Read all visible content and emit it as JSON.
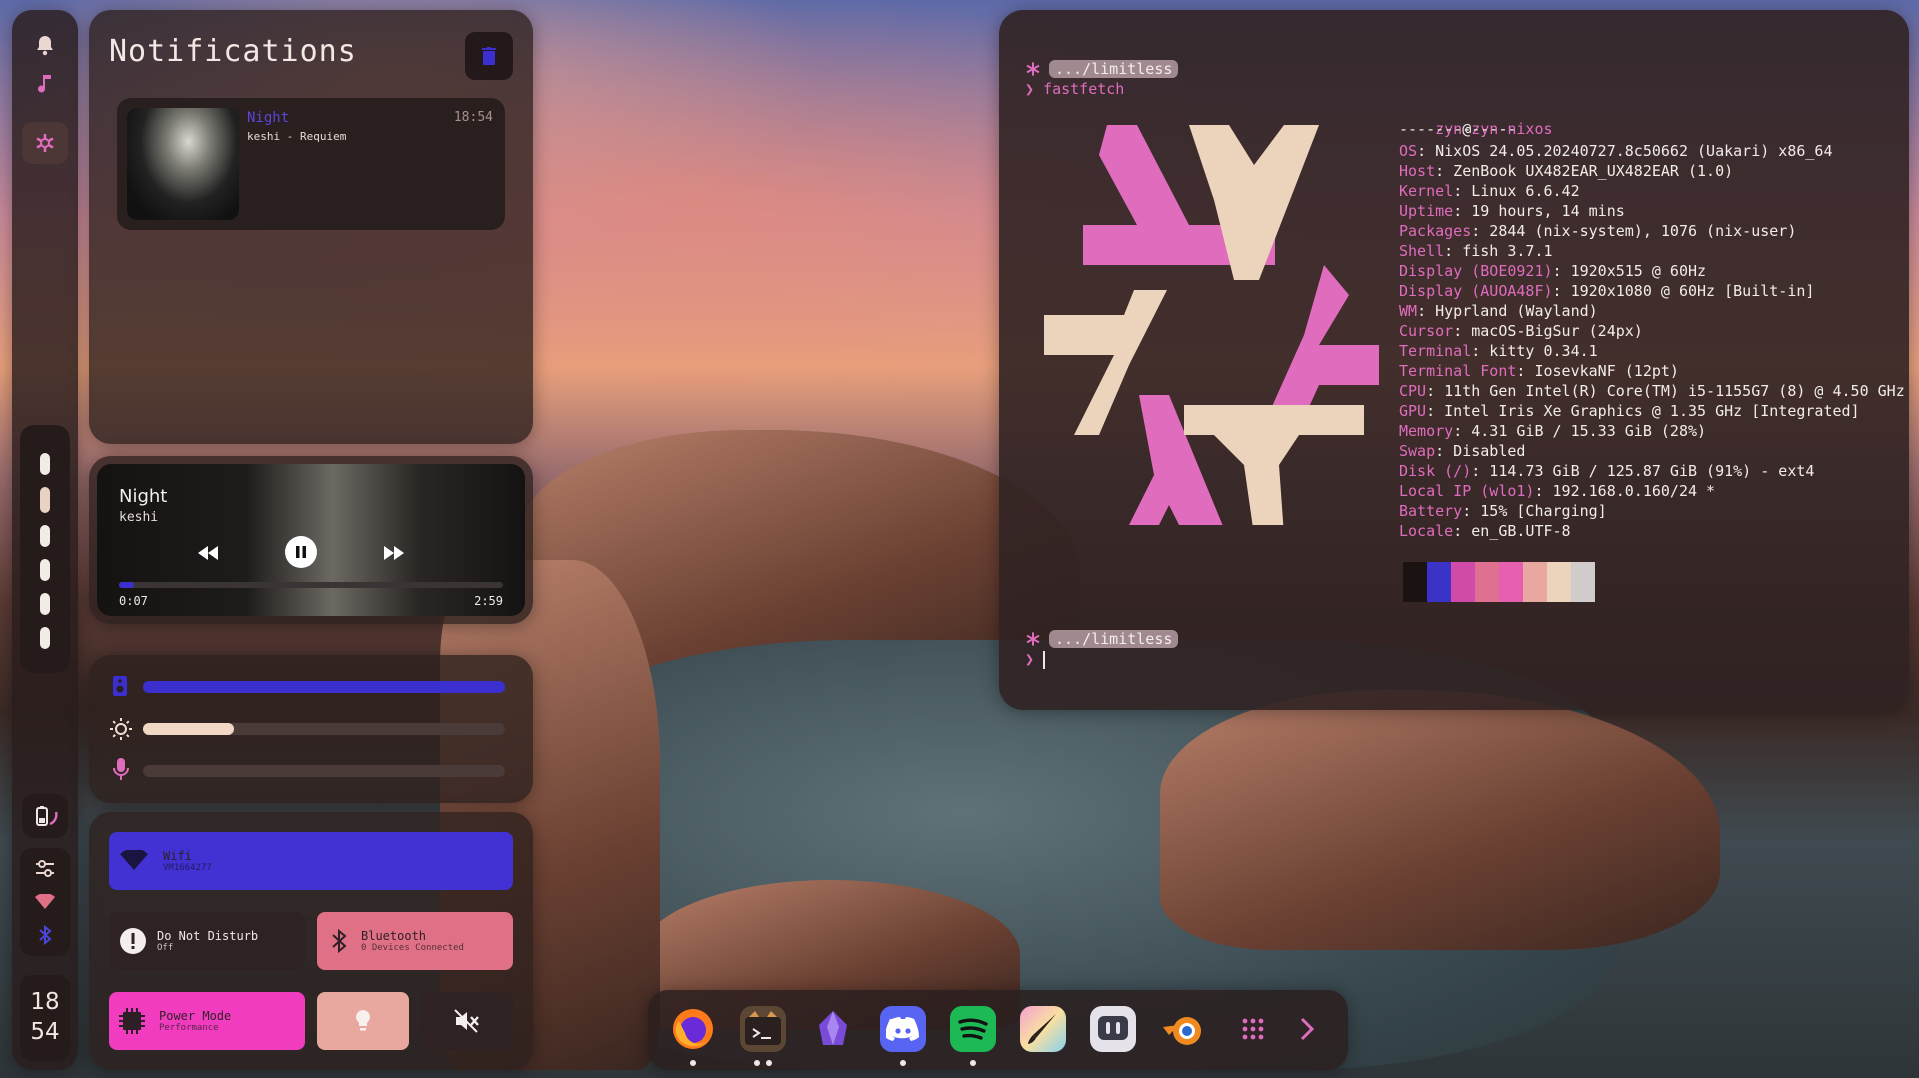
{
  "sidebar": {
    "clock_hour": "18",
    "clock_minute": "54",
    "workspaces": [
      {
        "state": "active-top"
      },
      {
        "state": "dim"
      },
      {
        "state": "normal"
      },
      {
        "state": "normal"
      },
      {
        "state": "normal"
      },
      {
        "state": "normal"
      }
    ]
  },
  "notifications": {
    "title": "Notifications",
    "items": [
      {
        "title": "Night",
        "body": "keshi - Requiem",
        "time": "18:54"
      }
    ]
  },
  "player": {
    "title": "Night",
    "artist": "keshi",
    "elapsed": "0:07",
    "duration": "2:59",
    "progress_fraction": 0.04
  },
  "sliders": {
    "volume_fraction": 1.0,
    "brightness_fraction": 0.25,
    "mic_fraction": 0.0
  },
  "toggles": {
    "wifi_label": "Wifi",
    "wifi_sub": "VM1664277",
    "dnd_label": "Do Not Disturb",
    "dnd_sub": "Off",
    "bt_label": "Bluetooth",
    "bt_sub": "0 Devices Connected",
    "power_label": "Power Mode",
    "power_sub": "Performance"
  },
  "terminal": {
    "prompt_path": ".../limitless",
    "command": "fastfetch",
    "user": "zyn",
    "at": "@",
    "host": "zyn-nixos",
    "separator": "-------------",
    "info": [
      {
        "key": "OS",
        "value": " NixOS 24.05.20240727.8c50662 (Uakari) x86_64"
      },
      {
        "key": "Host",
        "value": " ZenBook UX482EAR_UX482EAR (1.0)"
      },
      {
        "key": "Kernel",
        "value": " Linux 6.6.42"
      },
      {
        "key": "Uptime",
        "value": " 19 hours, 14 mins"
      },
      {
        "key": "Packages",
        "value": " 2844 (nix-system), 1076 (nix-user)"
      },
      {
        "key": "Shell",
        "value": " fish 3.7.1"
      },
      {
        "key": "Display (BOE0921)",
        "value": " 1920x515 @ 60Hz"
      },
      {
        "key": "Display (AUOA48F)",
        "value": " 1920x1080 @ 60Hz [Built-in]"
      },
      {
        "key": "WM",
        "value": " Hyprland (Wayland)"
      },
      {
        "key": "Cursor",
        "value": " macOS-BigSur (24px)"
      },
      {
        "key": "Terminal",
        "value": " kitty 0.34.1"
      },
      {
        "key": "Terminal Font",
        "value": " IosevkaNF (12pt)"
      },
      {
        "key": "CPU",
        "value": " 11th Gen Intel(R) Core(TM) i5-1155G7 (8) @ 4.50 GHz"
      },
      {
        "key": "GPU",
        "value": " Intel Iris Xe Graphics @ 1.35 GHz [Integrated]"
      },
      {
        "key": "Memory",
        "value": " 4.31 GiB / 15.33 GiB (28%)"
      },
      {
        "key": "Swap",
        "value": " Disabled"
      },
      {
        "key": "Disk (/)",
        "value": " 114.73 GiB / 125.87 GiB (91%) - ext4"
      },
      {
        "key": "Local IP (wlo1)",
        "value": " 192.168.0.160/24 *"
      },
      {
        "key": "Battery",
        "value": " 15% [Charging]"
      },
      {
        "key": "Locale",
        "value": " en_GB.UTF-8"
      }
    ],
    "palette": [
      "#1b1212",
      "#3b32c8",
      "#d04aa8",
      "#e07090",
      "#e65fb0",
      "#e8a8a0",
      "#ecd4bc",
      "#d0cccc"
    ]
  },
  "dock": {
    "apps": [
      {
        "name": "firefox",
        "running": true
      },
      {
        "name": "terminal",
        "running": true
      },
      {
        "name": "obsidian",
        "running": false
      },
      {
        "name": "discord",
        "running": true
      },
      {
        "name": "spotify",
        "running": true
      },
      {
        "name": "krita",
        "running": false
      },
      {
        "name": "vesktop",
        "running": false
      },
      {
        "name": "blender",
        "running": false
      }
    ]
  },
  "colors": {
    "accent_blue": "#3b2fd0",
    "accent_pink": "#e06cbe",
    "hot_pink": "#f23cc0",
    "salmon": "#e07086",
    "cream": "#f0d8c4"
  }
}
